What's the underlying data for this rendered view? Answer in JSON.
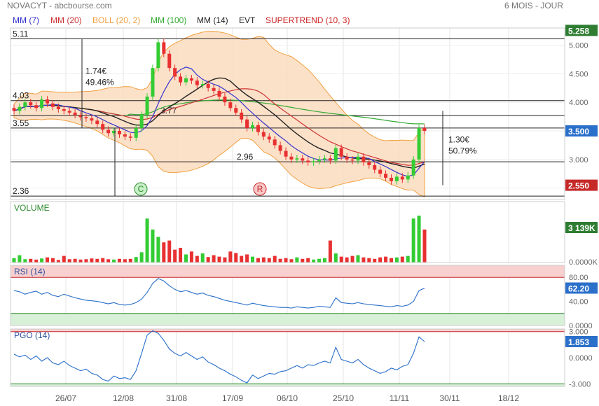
{
  "header": {
    "title": "NOVACYT - abcbourse.com",
    "period": "6 MOIS - JOUR"
  },
  "colors": {
    "mm7": "#3333cc",
    "mm20": "#cc3333",
    "boll": "#f0a040",
    "boll_fill": "#fbdcc0",
    "mm100": "#33aa33",
    "mm14": "#222222",
    "supertrend": "#cc2222",
    "up": "#33cc33",
    "down": "#e83030",
    "rsi_line": "#2a6fc9",
    "zone_high": "#f8d0d0",
    "zone_low": "#d8efd8",
    "price_badge": "#2e7d32",
    "low_badge": "#c62828"
  },
  "legend": [
    {
      "key": "mm7",
      "label": "MM (7)"
    },
    {
      "key": "mm20",
      "label": "MM (20)"
    },
    {
      "key": "boll",
      "label": "BOLL (20, 2)"
    },
    {
      "key": "mm100",
      "label": "MM (100)"
    },
    {
      "key": "mm14",
      "label": "MM (14)"
    },
    {
      "key": "evt",
      "label": "EVT"
    },
    {
      "key": "supertrend",
      "label": "SUPERTREND (10, 3)"
    }
  ],
  "chart_data": [
    {
      "type": "candlestick",
      "title": "NOVACYT",
      "ylim": [
        2.3,
        5.3
      ],
      "y_ticks": [
        "5.000",
        "4.500",
        "4.000",
        "3.500",
        "3.000",
        "2.500"
      ],
      "x_ticks": [
        "26/07",
        "12/08",
        "31/08",
        "17/09",
        "06/10",
        "25/10",
        "11/11",
        "30/11",
        "18/12"
      ],
      "current_price": "3.500",
      "period_high_label": "5.258",
      "period_low_label": "2.550",
      "levels": [
        {
          "label": "5.11",
          "value": 5.11
        },
        {
          "label": "4.03",
          "value": 4.03
        },
        {
          "label": "3.77",
          "value": 3.77
        },
        {
          "label": "3.55",
          "value": 3.55
        },
        {
          "label": "2.96",
          "value": 2.96
        },
        {
          "label": "2.36",
          "value": 2.36
        }
      ],
      "annotations": [
        {
          "text": "1.74€",
          "sub": "49.46%"
        },
        {
          "text": "1.30€",
          "sub": "50.79%"
        }
      ],
      "events": [
        "C",
        "R"
      ],
      "series_close": [
        3.85,
        3.92,
        4.0,
        3.95,
        3.9,
        4.05,
        3.98,
        3.92,
        3.88,
        3.85,
        3.82,
        3.78,
        3.74,
        3.72,
        3.68,
        3.62,
        3.52,
        3.46,
        3.5,
        3.44,
        3.4,
        3.38,
        3.55,
        3.78,
        4.1,
        4.6,
        5.05,
        4.85,
        4.6,
        4.45,
        4.35,
        4.42,
        4.38,
        4.3,
        4.32,
        4.25,
        4.2,
        4.1,
        4.0,
        3.9,
        3.82,
        3.7,
        3.55,
        3.6,
        3.48,
        3.4,
        3.35,
        3.25,
        3.15,
        3.05,
        3.0,
        3.02,
        2.98,
        2.95,
        2.97,
        3.0,
        3.02,
        2.98,
        3.2,
        3.05,
        3.0,
        2.98,
        3.05,
        2.95,
        2.9,
        2.82,
        2.75,
        2.68,
        2.62,
        2.7,
        2.65,
        2.72,
        3.0,
        3.55,
        3.5
      ]
    },
    {
      "type": "bar",
      "title": "VOLUME",
      "current_value": "3 139K",
      "y_ticks": [
        "0.0000K"
      ],
      "values": [
        12,
        20,
        9,
        10,
        8,
        11,
        14,
        12,
        7,
        18,
        9,
        10,
        8,
        9,
        11,
        10,
        12,
        9,
        8,
        10,
        9,
        10,
        15,
        28,
        120,
        90,
        70,
        55,
        60,
        35,
        40,
        22,
        30,
        18,
        25,
        15,
        20,
        16,
        14,
        30,
        26,
        18,
        22,
        16,
        12,
        14,
        12,
        18,
        10,
        12,
        9,
        14,
        10,
        12,
        8,
        10,
        12,
        60,
        25,
        16,
        14,
        18,
        20,
        14,
        12,
        10,
        14,
        16,
        12,
        14,
        16,
        18,
        120,
        128,
        90
      ]
    },
    {
      "type": "line",
      "title": "RSI (14)",
      "current_value": "62.20",
      "y_ticks": [
        "80.00",
        "40.00",
        "0.0000"
      ],
      "ylim": [
        0,
        100
      ],
      "values": [
        58,
        56,
        52,
        55,
        57,
        52,
        55,
        50,
        48,
        52,
        49,
        46,
        44,
        42,
        41,
        40,
        38,
        36,
        38,
        35,
        34,
        35,
        38,
        44,
        55,
        70,
        78,
        74,
        66,
        60,
        56,
        58,
        55,
        52,
        54,
        50,
        48,
        45,
        42,
        40,
        38,
        36,
        34,
        37,
        35,
        33,
        32,
        31,
        30,
        30,
        29,
        31,
        30,
        29,
        30,
        32,
        31,
        30,
        46,
        38,
        37,
        36,
        38,
        36,
        35,
        34,
        33,
        32,
        31,
        33,
        32,
        34,
        40,
        58,
        62
      ]
    },
    {
      "type": "line",
      "title": "PGO (14)",
      "current_value": "1.853",
      "y_ticks": [
        "3.000",
        "0.0000",
        "-3.000"
      ],
      "ylim": [
        -3.3,
        3.3
      ],
      "values": [
        0.4,
        0.1,
        0.3,
        -0.2,
        0.2,
        -0.4,
        0.0,
        -0.6,
        -0.8,
        -0.4,
        -0.9,
        -1.2,
        -1.5,
        -1.3,
        -1.8,
        -2.0,
        -2.5,
        -2.7,
        -2.1,
        -2.4,
        -2.3,
        -2.5,
        -1.5,
        0.5,
        2.6,
        3.1,
        2.8,
        2.0,
        1.0,
        0.5,
        0.2,
        0.6,
        0.2,
        -0.2,
        0.1,
        -0.5,
        -0.8,
        -1.2,
        -1.5,
        -1.9,
        -2.2,
        -2.6,
        -2.9,
        -2.0,
        -2.4,
        -2.1,
        -1.8,
        -1.9,
        -1.6,
        -1.5,
        -1.2,
        -0.9,
        -1.2,
        -0.8,
        -0.9,
        -0.6,
        -0.4,
        -0.6,
        1.2,
        -0.2,
        -0.4,
        -0.6,
        -0.2,
        -0.8,
        -1.2,
        -1.5,
        -1.8,
        -1.6,
        -1.2,
        -1.4,
        -1.0,
        -0.8,
        0.5,
        2.4,
        1.85
      ]
    }
  ]
}
